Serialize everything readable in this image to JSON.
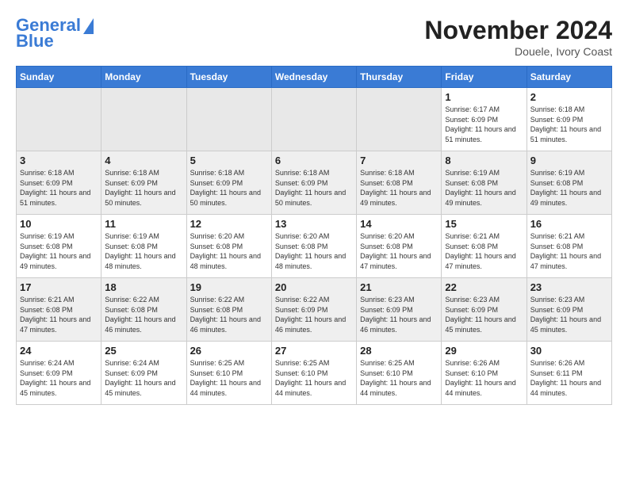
{
  "header": {
    "logo_line1": "General",
    "logo_line2": "Blue",
    "month_title": "November 2024",
    "location": "Douele, Ivory Coast"
  },
  "weekdays": [
    "Sunday",
    "Monday",
    "Tuesday",
    "Wednesday",
    "Thursday",
    "Friday",
    "Saturday"
  ],
  "weeks": [
    [
      {
        "day": "",
        "info": ""
      },
      {
        "day": "",
        "info": ""
      },
      {
        "day": "",
        "info": ""
      },
      {
        "day": "",
        "info": ""
      },
      {
        "day": "",
        "info": ""
      },
      {
        "day": "1",
        "info": "Sunrise: 6:17 AM\nSunset: 6:09 PM\nDaylight: 11 hours and 51 minutes."
      },
      {
        "day": "2",
        "info": "Sunrise: 6:18 AM\nSunset: 6:09 PM\nDaylight: 11 hours and 51 minutes."
      }
    ],
    [
      {
        "day": "3",
        "info": "Sunrise: 6:18 AM\nSunset: 6:09 PM\nDaylight: 11 hours and 51 minutes."
      },
      {
        "day": "4",
        "info": "Sunrise: 6:18 AM\nSunset: 6:09 PM\nDaylight: 11 hours and 50 minutes."
      },
      {
        "day": "5",
        "info": "Sunrise: 6:18 AM\nSunset: 6:09 PM\nDaylight: 11 hours and 50 minutes."
      },
      {
        "day": "6",
        "info": "Sunrise: 6:18 AM\nSunset: 6:09 PM\nDaylight: 11 hours and 50 minutes."
      },
      {
        "day": "7",
        "info": "Sunrise: 6:18 AM\nSunset: 6:08 PM\nDaylight: 11 hours and 49 minutes."
      },
      {
        "day": "8",
        "info": "Sunrise: 6:19 AM\nSunset: 6:08 PM\nDaylight: 11 hours and 49 minutes."
      },
      {
        "day": "9",
        "info": "Sunrise: 6:19 AM\nSunset: 6:08 PM\nDaylight: 11 hours and 49 minutes."
      }
    ],
    [
      {
        "day": "10",
        "info": "Sunrise: 6:19 AM\nSunset: 6:08 PM\nDaylight: 11 hours and 49 minutes."
      },
      {
        "day": "11",
        "info": "Sunrise: 6:19 AM\nSunset: 6:08 PM\nDaylight: 11 hours and 48 minutes."
      },
      {
        "day": "12",
        "info": "Sunrise: 6:20 AM\nSunset: 6:08 PM\nDaylight: 11 hours and 48 minutes."
      },
      {
        "day": "13",
        "info": "Sunrise: 6:20 AM\nSunset: 6:08 PM\nDaylight: 11 hours and 48 minutes."
      },
      {
        "day": "14",
        "info": "Sunrise: 6:20 AM\nSunset: 6:08 PM\nDaylight: 11 hours and 47 minutes."
      },
      {
        "day": "15",
        "info": "Sunrise: 6:21 AM\nSunset: 6:08 PM\nDaylight: 11 hours and 47 minutes."
      },
      {
        "day": "16",
        "info": "Sunrise: 6:21 AM\nSunset: 6:08 PM\nDaylight: 11 hours and 47 minutes."
      }
    ],
    [
      {
        "day": "17",
        "info": "Sunrise: 6:21 AM\nSunset: 6:08 PM\nDaylight: 11 hours and 47 minutes."
      },
      {
        "day": "18",
        "info": "Sunrise: 6:22 AM\nSunset: 6:08 PM\nDaylight: 11 hours and 46 minutes."
      },
      {
        "day": "19",
        "info": "Sunrise: 6:22 AM\nSunset: 6:08 PM\nDaylight: 11 hours and 46 minutes."
      },
      {
        "day": "20",
        "info": "Sunrise: 6:22 AM\nSunset: 6:09 PM\nDaylight: 11 hours and 46 minutes."
      },
      {
        "day": "21",
        "info": "Sunrise: 6:23 AM\nSunset: 6:09 PM\nDaylight: 11 hours and 46 minutes."
      },
      {
        "day": "22",
        "info": "Sunrise: 6:23 AM\nSunset: 6:09 PM\nDaylight: 11 hours and 45 minutes."
      },
      {
        "day": "23",
        "info": "Sunrise: 6:23 AM\nSunset: 6:09 PM\nDaylight: 11 hours and 45 minutes."
      }
    ],
    [
      {
        "day": "24",
        "info": "Sunrise: 6:24 AM\nSunset: 6:09 PM\nDaylight: 11 hours and 45 minutes."
      },
      {
        "day": "25",
        "info": "Sunrise: 6:24 AM\nSunset: 6:09 PM\nDaylight: 11 hours and 45 minutes."
      },
      {
        "day": "26",
        "info": "Sunrise: 6:25 AM\nSunset: 6:10 PM\nDaylight: 11 hours and 44 minutes."
      },
      {
        "day": "27",
        "info": "Sunrise: 6:25 AM\nSunset: 6:10 PM\nDaylight: 11 hours and 44 minutes."
      },
      {
        "day": "28",
        "info": "Sunrise: 6:25 AM\nSunset: 6:10 PM\nDaylight: 11 hours and 44 minutes."
      },
      {
        "day": "29",
        "info": "Sunrise: 6:26 AM\nSunset: 6:10 PM\nDaylight: 11 hours and 44 minutes."
      },
      {
        "day": "30",
        "info": "Sunrise: 6:26 AM\nSunset: 6:11 PM\nDaylight: 11 hours and 44 minutes."
      }
    ]
  ]
}
